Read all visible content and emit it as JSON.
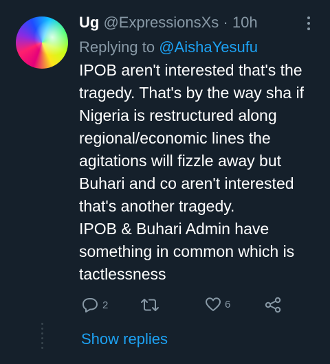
{
  "tweet": {
    "display_name": "Ug",
    "handle": "@ExpressionsXs",
    "separator": "·",
    "time": "10h",
    "replying_prefix": "Replying to",
    "replying_to": "@AishaYesufu",
    "body_paragraphs": [
      "IPOB aren't interested that's the tragedy. That's by the way sha if Nigeria is restructured along regional/economic lines the agitations will fizzle away but Buhari and co aren't interested that's another tragedy.",
      "IPOB & Buhari Admin have something in common which is tactlessness"
    ]
  },
  "actions": {
    "reply_count": "2",
    "retweet_count": "",
    "like_count": "6"
  },
  "icons": {
    "avatar": "avatar-gradient",
    "more": "more-vertical-icon",
    "reply": "reply-icon",
    "retweet": "retweet-icon",
    "like": "heart-icon",
    "share": "share-icon"
  },
  "show_replies": "Show replies",
  "colors": {
    "background": "#15202b",
    "text": "#ffffff",
    "secondary": "#8899a6",
    "accent": "#1da1f2"
  }
}
